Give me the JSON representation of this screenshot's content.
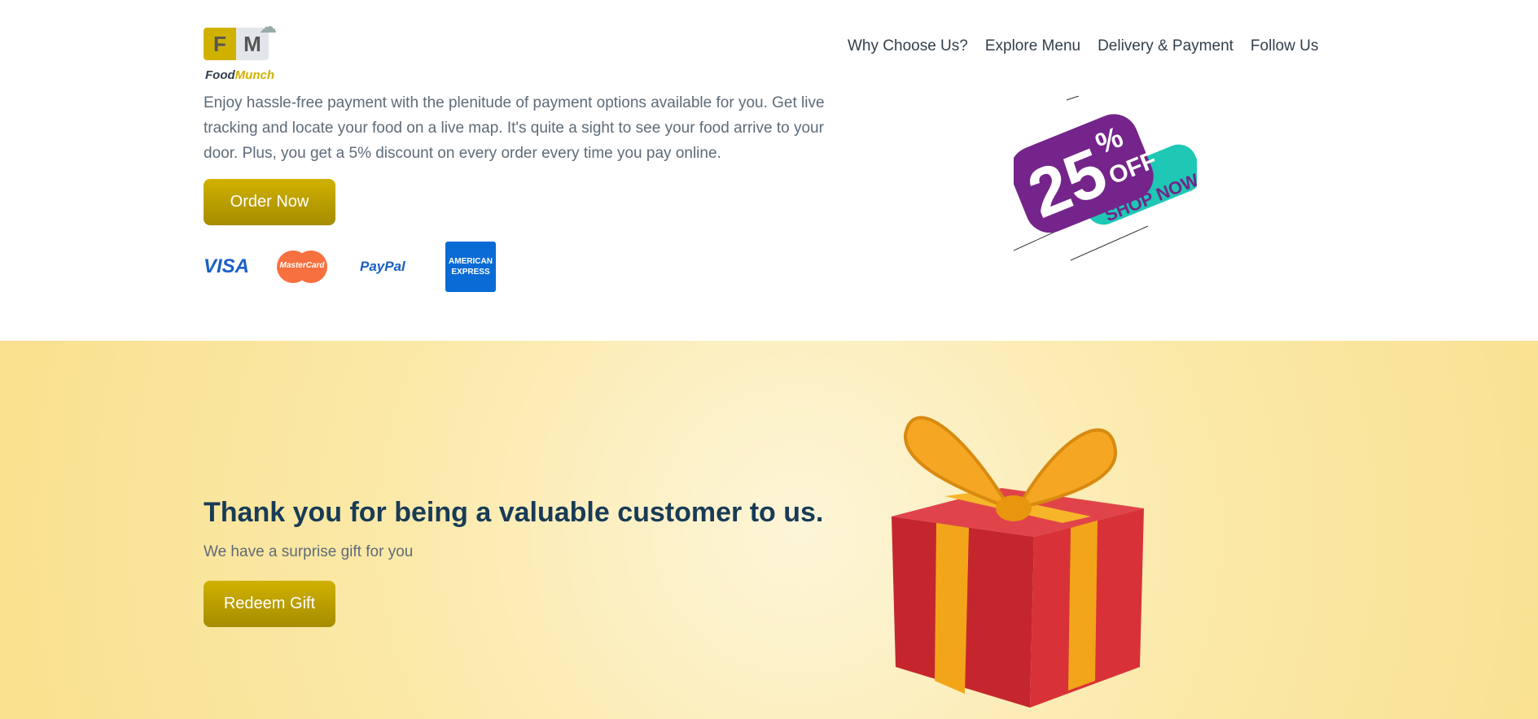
{
  "logo": {
    "initials_f": "F",
    "initials_m": "M",
    "brand_food": "Food",
    "brand_munch": "Munch"
  },
  "nav": [
    "Why Choose Us?",
    "Explore Menu",
    "Delivery & Payment",
    "Follow Us"
  ],
  "payment": {
    "description": "Enjoy hassle-free payment with the plenitude of payment options available for you. Get live tracking and locate your food on a live map. It's quite a sight to see your food arrive to your door. Plus, you get a 5% discount on every order every time you pay online.",
    "order_button": "Order Now",
    "cards": {
      "visa": "VISA",
      "mastercard": "MasterCard",
      "paypal": "PayPal",
      "amex1": "AMERICAN",
      "amex2": "EXPRESS"
    }
  },
  "offer": {
    "amount": "25",
    "percent": "%",
    "off": "OFF",
    "shop": "SHOP NOW"
  },
  "thanks": {
    "title": "Thank you for being a valuable customer to us.",
    "subtitle": "We have a surprise gift for you",
    "button": "Redeem Gift"
  },
  "colors": {
    "accent": "#d0b100",
    "heading": "#183b56",
    "text": "#5e6b78",
    "offer_purple": "#74248a",
    "offer_teal": "#1ec8b4"
  }
}
